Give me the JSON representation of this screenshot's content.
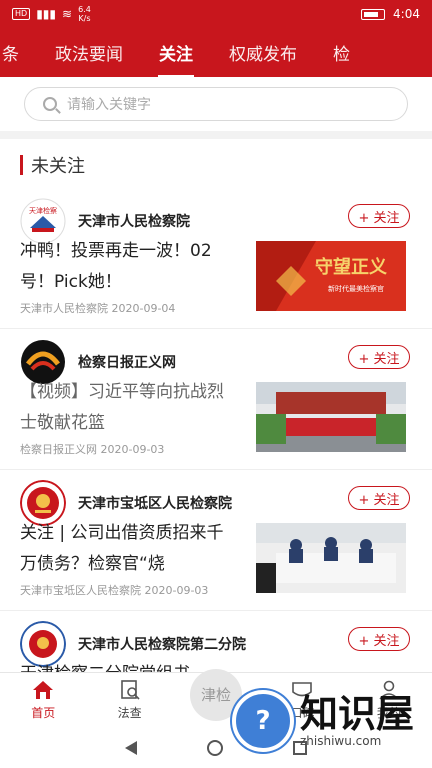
{
  "status": {
    "badge": "HD",
    "net_speed": "6.4",
    "net_unit": "K/s",
    "time": "4:04"
  },
  "nav": {
    "items": [
      "条",
      "政法要闻",
      "关注",
      "权威发布",
      "检"
    ],
    "active_index": 2
  },
  "search": {
    "placeholder": "请输入关键字"
  },
  "section": {
    "title": "未关注"
  },
  "feed": [
    {
      "source": "天津市人民检察院",
      "follow": "+ 关注",
      "title": "冲鸭！投票再走一波！02号！Pick她！",
      "meta": "天津市人民检察院 2020-09-04",
      "thumb_text": "守望正义",
      "thumb_sub": "新时代最美检察官"
    },
    {
      "source": "检察日报正义网",
      "follow": "+ 关注",
      "title": "【视频】习近平等向抗战烈士敬献花篮",
      "meta": "检察日报正义网 2020-09-03"
    },
    {
      "source": "天津市宝坻区人民检察院",
      "follow": "+ 关注",
      "title": "关注 | 公司出借资质招来千万债务？检察官“烧",
      "meta": "天津市宝坻区人民检察院 2020-09-03"
    },
    {
      "source": "天津市人民检察院第二分院",
      "follow": "+ 关注",
      "title": "天津检察二分院党组书",
      "meta": ""
    }
  ],
  "tabs": {
    "home": "首页",
    "search": "法查",
    "center": "津检",
    "mouth": "口碑",
    "mine": "我的"
  },
  "watermark": {
    "big": "知识屋",
    "small": "zhishiwu.com",
    "mark": "?"
  },
  "colors": {
    "brand": "#c8161d"
  }
}
